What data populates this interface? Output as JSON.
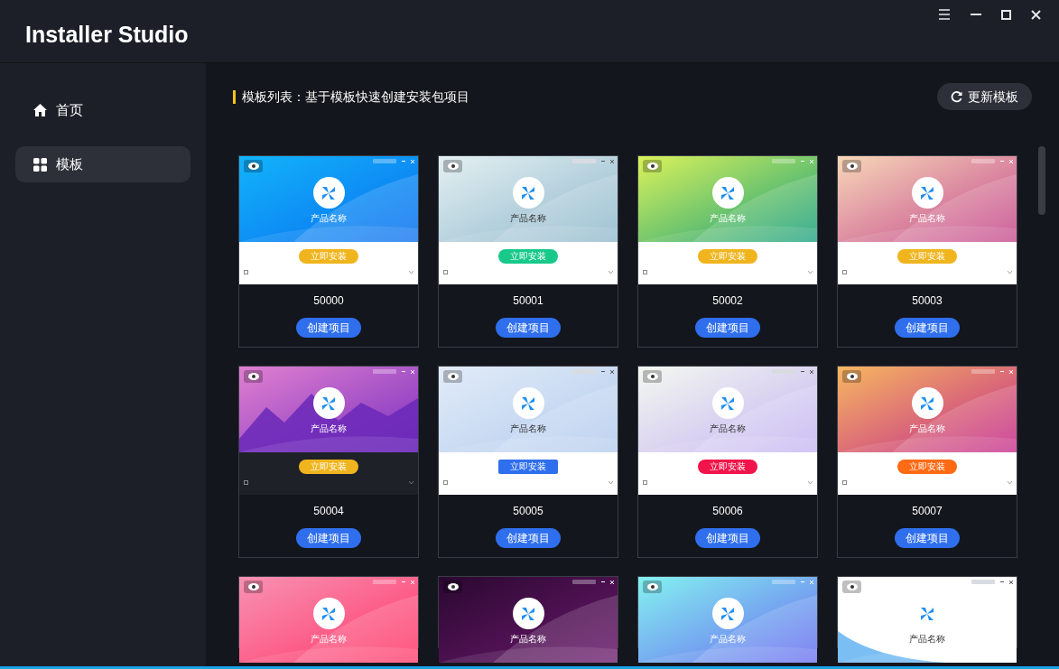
{
  "app": {
    "title": "Installer Studio"
  },
  "window_controls": [
    {
      "kind": "menu"
    },
    {
      "kind": "minimize"
    },
    {
      "kind": "maximize"
    },
    {
      "kind": "close"
    }
  ],
  "sidebar": {
    "items": [
      {
        "label": "首页",
        "kind": "home",
        "selected": false
      },
      {
        "label": "模板",
        "kind": "grid",
        "selected": true
      }
    ]
  },
  "header": {
    "title": "模板列表：基于模板快速创建安装包项目",
    "refresh_button": "更新模板"
  },
  "templates": [
    {
      "title": "产品名称",
      "install": "立即安装",
      "color": "#f0b51e",
      "agreed": false,
      "id": "50000",
      "action": "创建项目"
    },
    {
      "title": "产品名称",
      "install": "立即安装",
      "color": "#18c98a",
      "agreed": false,
      "id": "50001",
      "action": "创建项目"
    },
    {
      "title": "产品名称",
      "install": "立即安装",
      "color": "#f0b51e",
      "agreed": false,
      "id": "50002",
      "action": "创建项目"
    },
    {
      "title": "产品名称",
      "install": "立即安装",
      "color": "#f0b51e",
      "agreed": false,
      "id": "50003",
      "action": "创建项目"
    },
    {
      "title": "产品名称",
      "install": "立即安装",
      "color": "#f0b51e",
      "agreed": false,
      "id": "50004",
      "action": "创建项目"
    },
    {
      "title": "产品名称",
      "install": "立即安装",
      "color": "#2f6fed",
      "agreed": false,
      "id": "50005",
      "action": "创建项目"
    },
    {
      "title": "产品名称",
      "install": "立即安装",
      "color": "#f0144a",
      "agreed": false,
      "id": "50006",
      "action": "创建项目"
    },
    {
      "title": "产品名称",
      "install": "立即安装",
      "color": "#ff6a14",
      "agreed": false,
      "id": "50007",
      "action": "创建项目"
    },
    {
      "title": "产品名称"
    },
    {
      "title": "产品名称"
    },
    {
      "title": "产品名称"
    },
    {
      "title": "产品名称"
    }
  ]
}
